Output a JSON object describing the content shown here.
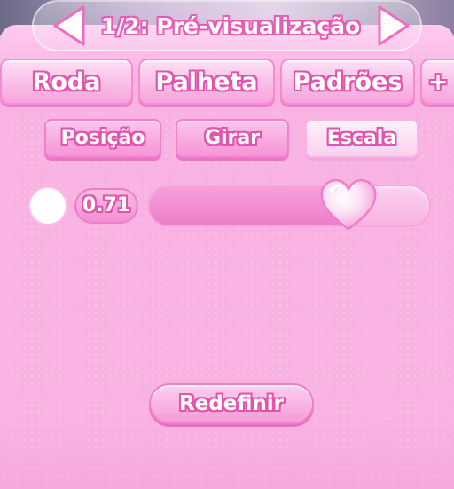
{
  "header": {
    "title": "1/2: Pré-visualização"
  },
  "tabs": [
    {
      "label": "Roda"
    },
    {
      "label": "Palheta"
    },
    {
      "label": "Padrões"
    },
    {
      "label": "+"
    }
  ],
  "subtabs": [
    {
      "label": "Posição",
      "active": false
    },
    {
      "label": "Girar",
      "active": false
    },
    {
      "label": "Escala",
      "active": true
    }
  ],
  "scale": {
    "value_text": "0.71",
    "fraction": 0.71
  },
  "reset": {
    "label": "Redefinir"
  },
  "colors": {
    "accent": "#e552ad",
    "panel": "#f9b3e3",
    "heart": "#f7b6e4"
  },
  "icons": {
    "prev": "triangle-left-icon",
    "next": "triangle-right-icon",
    "handle": "heart-icon"
  }
}
